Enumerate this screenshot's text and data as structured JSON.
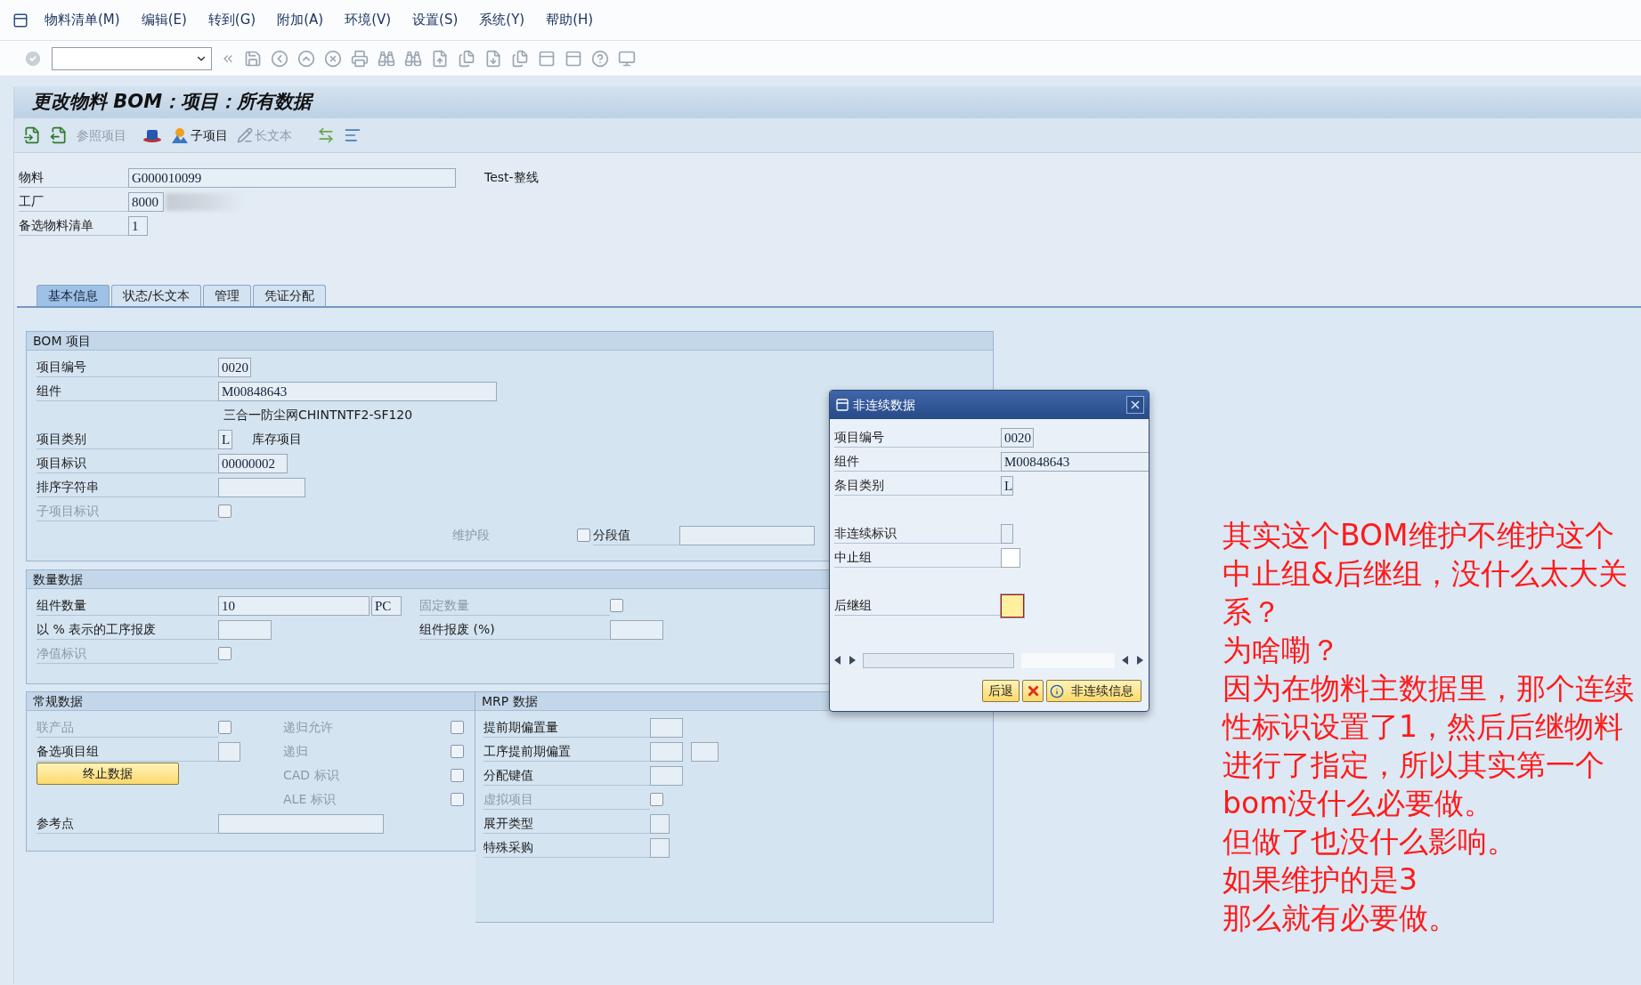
{
  "menu": [
    {
      "label": "物料清单(M)"
    },
    {
      "label": "编辑(E)"
    },
    {
      "label": "转到(G)"
    },
    {
      "label": "附加(A)"
    },
    {
      "label": "环境(V)"
    },
    {
      "label": "设置(S)"
    },
    {
      "label": "系统(Y)"
    },
    {
      "label": "帮助(H)"
    }
  ],
  "title": "更改物料 BOM：项目：所有数据",
  "app_toolbar": [
    {
      "label": "参照项目",
      "disabled": true
    },
    {
      "label": "子项目",
      "disabled": false
    },
    {
      "label": "长文本",
      "disabled": true
    }
  ],
  "header": {
    "fields": [
      {
        "label": "物料",
        "value": "G000010099"
      },
      {
        "label": "工厂",
        "value": "8000"
      },
      {
        "label": "备选物料清单",
        "value": "1"
      }
    ],
    "material_description": "Test-整线"
  },
  "tabs": [
    {
      "label": "基本信息",
      "selected": true
    },
    {
      "label": "状态/长文本",
      "selected": false
    },
    {
      "label": "管理",
      "selected": false
    },
    {
      "label": "凭证分配",
      "selected": false
    }
  ],
  "bom_item": {
    "title": "BOM 项目",
    "item_number": {
      "label": "项目编号",
      "value": "0020"
    },
    "component": {
      "label": "组件",
      "value": "M00848643",
      "description": "三合一防尘网CHINTNTF2-SF120"
    },
    "item_category": {
      "label": "项目类别",
      "value": "L",
      "text": "库存项目"
    },
    "item_id": {
      "label": "项目标识",
      "value": "00000002"
    },
    "sort_string": {
      "label": "排序字符串"
    },
    "sub_item_indicator": {
      "label": "子项目标识",
      "disabled": true,
      "checked": false
    },
    "maintenance_segment": {
      "label": "维护段",
      "disabled": true
    },
    "segment_value": {
      "label": "分段值",
      "checked": false
    }
  },
  "quantity": {
    "title": "数量数据",
    "component_quantity": {
      "label": "组件数量",
      "value": "10",
      "unit": "PC"
    },
    "fixed_quantity": {
      "label": "固定数量",
      "disabled": true,
      "checked": false
    },
    "operation_scrap": {
      "label": "以 % 表示的工序报废"
    },
    "component_scrap": {
      "label": "组件报废 (%)"
    },
    "net_id": {
      "label": "净值标识",
      "disabled": true,
      "checked": false
    }
  },
  "general": {
    "title": "常规数据",
    "co_product": {
      "label": "联产品",
      "disabled": true,
      "checked": false
    },
    "alt_item_group": {
      "label": "备选项目组"
    },
    "button": "终止数据",
    "reference_point": {
      "label": "参考点"
    },
    "checks": [
      {
        "label": "递归允许",
        "disabled": true,
        "checked": false
      },
      {
        "label": "递归",
        "disabled": true,
        "checked": false
      },
      {
        "label": "CAD 标识",
        "disabled": true,
        "checked": false
      },
      {
        "label": "ALE 标识",
        "disabled": true,
        "checked": false
      }
    ]
  },
  "mrp": {
    "title": "MRP 数据",
    "lead_time_offset": {
      "label": "提前期偏置量"
    },
    "op_lead_time_offset": {
      "label": "工序提前期偏置"
    },
    "distribution_key": {
      "label": "分配键值"
    },
    "phantom_item": {
      "label": "虚拟项目",
      "disabled": true,
      "checked": false
    },
    "explosion_type": {
      "label": "展开类型"
    },
    "special_procurement": {
      "label": "特殊采购"
    }
  },
  "dialog": {
    "title": "非连续数据",
    "item_number": {
      "label": "项目编号",
      "value": "0020"
    },
    "component": {
      "label": "组件",
      "value": "M00848643"
    },
    "item_category": {
      "label": "条目类别",
      "value": "L"
    },
    "discontinuation_indicator": {
      "label": "非连续标识"
    },
    "discontinuation_group": {
      "label": "中止组"
    },
    "follow_up_group": {
      "label": "后继组",
      "focused": true
    },
    "buttons": {
      "back": "后退",
      "info": "非连续信息"
    }
  },
  "annotation": [
    "其实这个BOM维护不维护这个中止组&后继组，没什么太大关系？",
    "为啥嘞？",
    "因为在物料主数据里，那个连续性标识设置了1，然后后继物料进行了指定，所以其实第一个bom没什么必要做。",
    "但做了也没什么影响。",
    "如果维护的是3",
    "那么就有必要做。"
  ]
}
